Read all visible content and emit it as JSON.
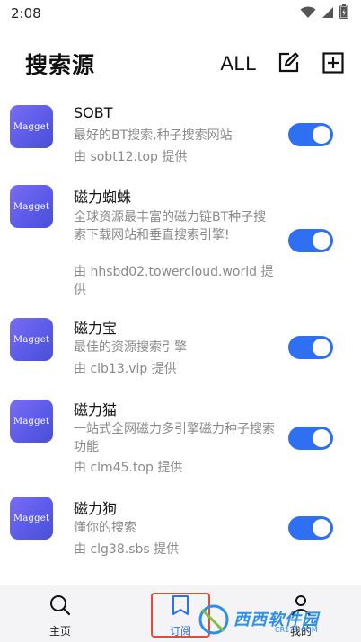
{
  "status_bar": {
    "time": "2:08"
  },
  "header": {
    "title": "搜索源",
    "all_label": "ALL",
    "edit_icon": "edit-icon",
    "add_icon": "add-box-icon"
  },
  "sources": [
    {
      "logo": "Magget",
      "name": "SOBT",
      "desc": "最好的BT搜索,种子搜索网站",
      "source": "由 sobt12.top 提供",
      "enabled": true
    },
    {
      "logo": "Magget",
      "name": "磁力蜘蛛",
      "desc": "全球资源最丰富的磁力链BT种子搜索下载网站和垂直搜索引擎!",
      "source": "由 hhsbd02.towercloud.world 提供",
      "enabled": true
    },
    {
      "logo": "Magget",
      "name": "磁力宝",
      "desc": "最佳的资源搜索引擎",
      "source": "由 clb13.vip 提供",
      "enabled": true
    },
    {
      "logo": "Magget",
      "name": "磁力猫",
      "desc": "一站式全网磁力多引擎磁力种子搜索功能",
      "source": "由 clm45.top 提供",
      "enabled": true
    },
    {
      "logo": "Magget",
      "name": "磁力狗",
      "desc": "懂你的搜索",
      "source": "由 clg38.sbs 提供",
      "enabled": true
    }
  ],
  "bottom_nav": {
    "items": [
      {
        "label": "主页",
        "icon": "search-icon"
      },
      {
        "label": "订阅",
        "icon": "subscribe-icon"
      },
      {
        "label": "我的",
        "icon": "profile-icon"
      }
    ]
  },
  "watermark": {
    "main": "西西软件园",
    "sub": "CR173.COM"
  },
  "colors": {
    "accent": "#2f6ff1",
    "highlight": "#e64a3b",
    "logo_gradient_start": "#7a6cf2",
    "logo_gradient_end": "#4a4fd6"
  }
}
